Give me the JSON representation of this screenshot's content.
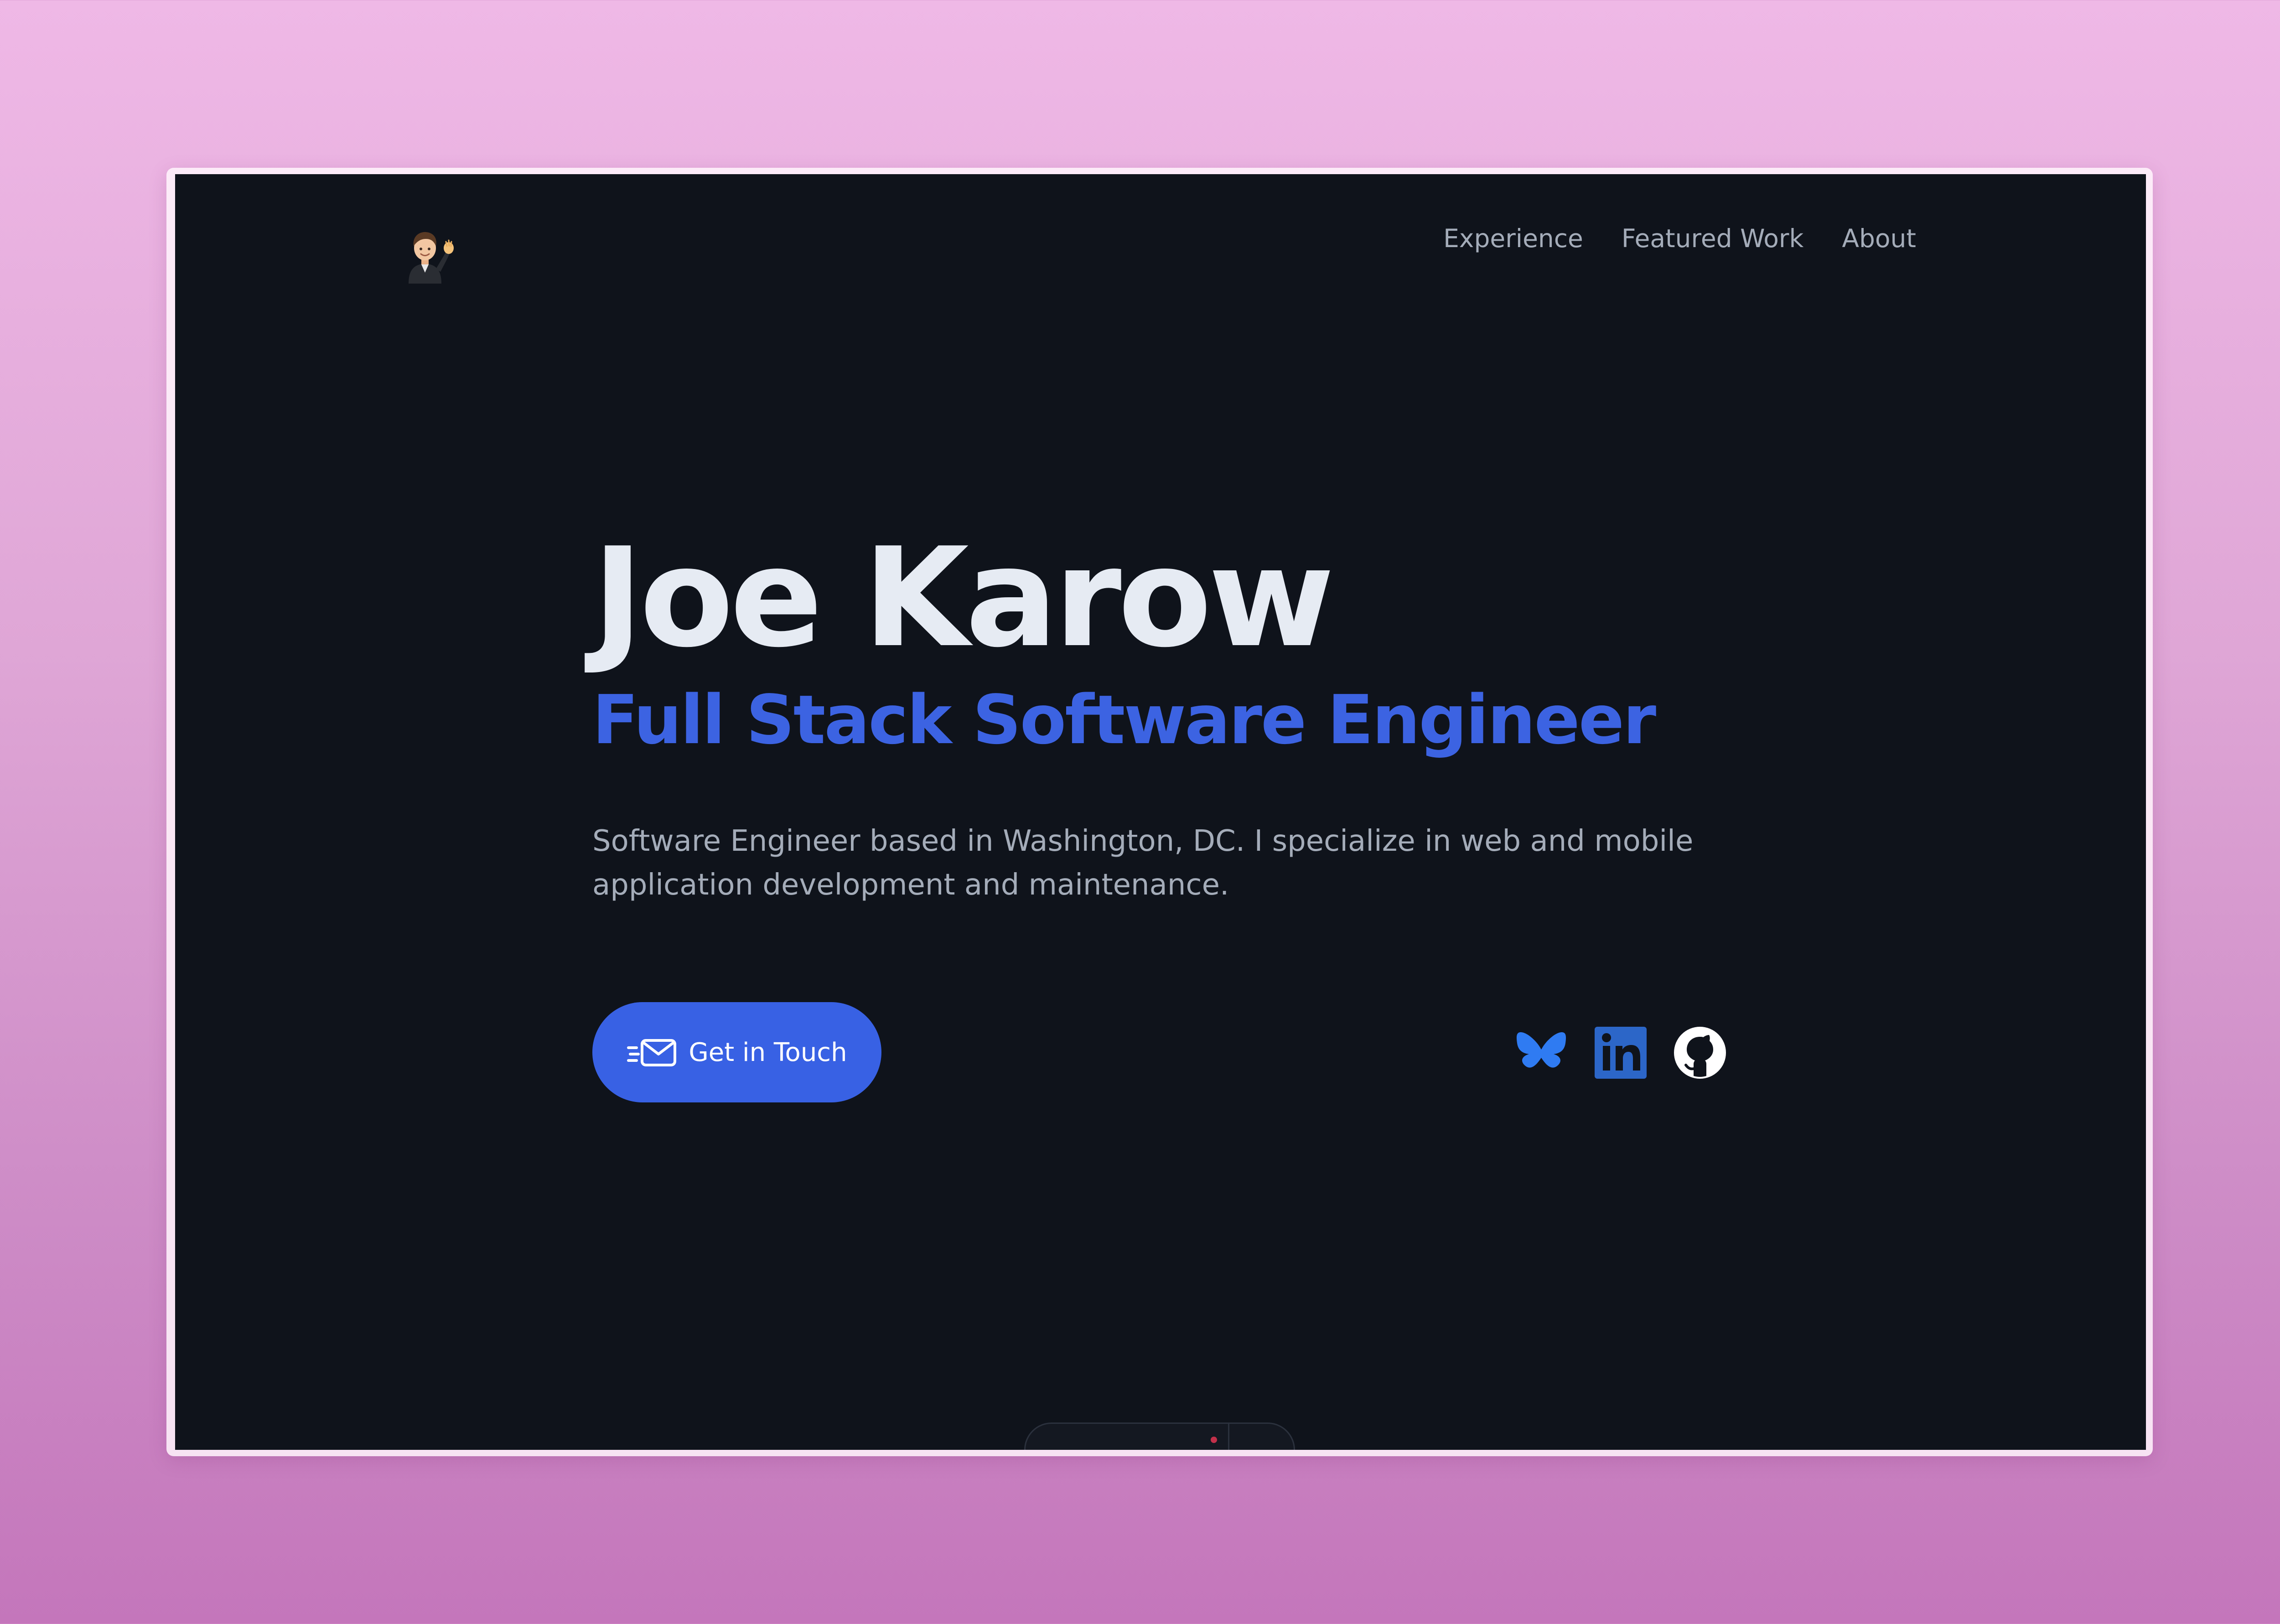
{
  "site": {
    "logo_icon": "waving-memoji-avatar"
  },
  "nav": {
    "items": [
      {
        "label": "Experience"
      },
      {
        "label": "Featured Work"
      },
      {
        "label": "About"
      }
    ]
  },
  "hero": {
    "name": "Joe Karow",
    "role": "Full Stack Software Engineer",
    "description": "Software Engineer based in Washington, DC. I specialize in web and mobile application development and maintenance."
  },
  "cta": {
    "label": "Get in Touch",
    "icon": "mail-fast-icon"
  },
  "socials": [
    {
      "icon": "bluesky-icon",
      "color": "#2f7bf2"
    },
    {
      "icon": "linkedin-icon",
      "color": "#2c66c8"
    },
    {
      "icon": "github-icon",
      "color": "#ffffff"
    }
  ],
  "colors": {
    "page_bg": "#0f131b",
    "name": "#e6ebf3",
    "accent": "#3c63e2",
    "muted_text": "#a4acb9",
    "button": "#3861e4"
  }
}
